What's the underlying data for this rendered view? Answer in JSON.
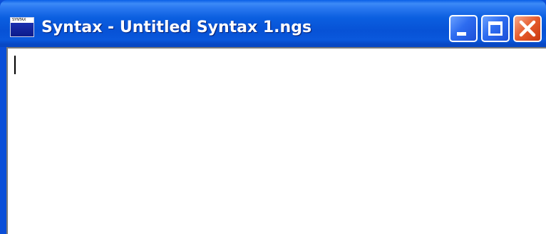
{
  "window": {
    "title": "Syntax - Untitled Syntax 1.ngs",
    "app_icon_text": "SYNTAX",
    "buttons": {
      "minimize": "minimize",
      "maximize": "maximize",
      "close": "close"
    }
  },
  "editor": {
    "content": ""
  },
  "colors": {
    "titlebar": "#0752d6",
    "close_button": "#e55a2b",
    "text": "#ffffff"
  }
}
